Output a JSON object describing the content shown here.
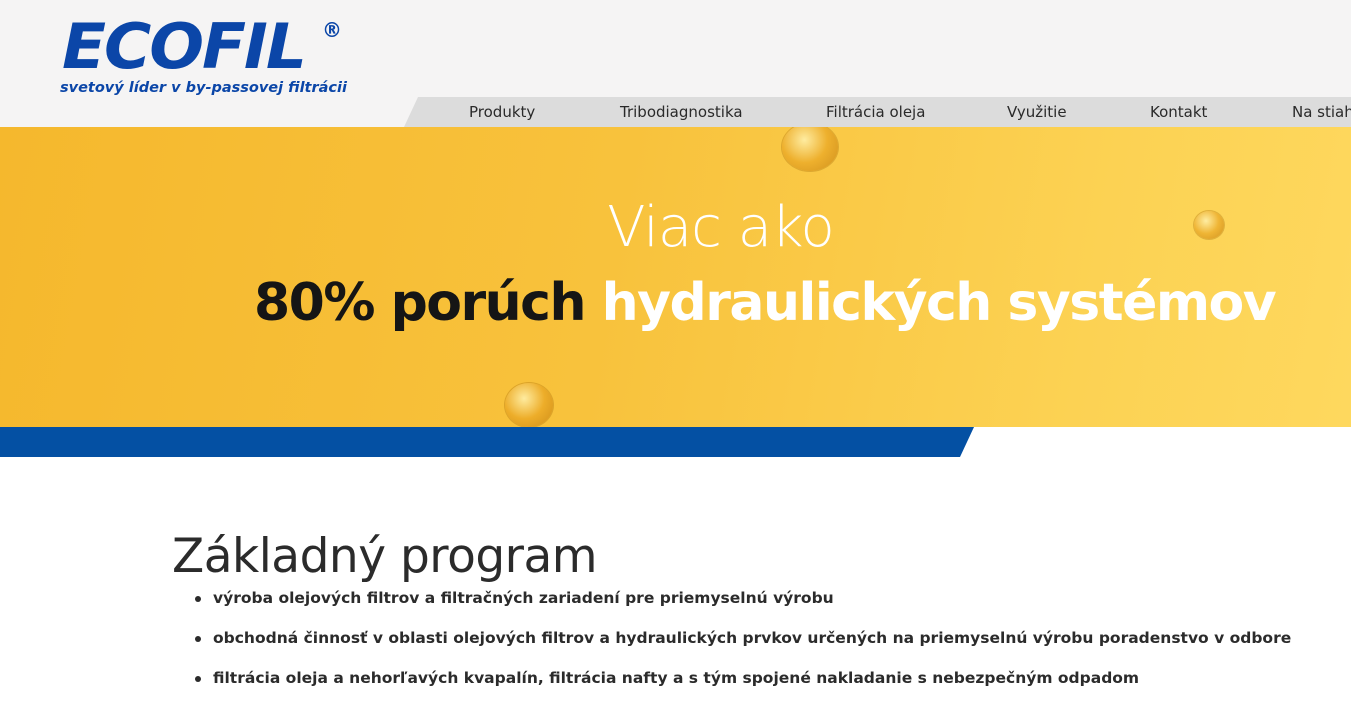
{
  "logo": {
    "wordmark": "ECOFIL",
    "registered": "®",
    "tagline": "svetový líder v by-passovej filtrácii"
  },
  "nav": {
    "items": [
      {
        "label": "Produkty"
      },
      {
        "label": "Tribodiagnostika"
      },
      {
        "label": "Filtrácia oleja"
      },
      {
        "label": "Využitie"
      },
      {
        "label": "Kontakt"
      },
      {
        "label": "Na stiah"
      }
    ]
  },
  "banner": {
    "line1": "Viac ako",
    "line2_dark": "80% porúch",
    "line2_light": "hydraulických systémov"
  },
  "main": {
    "title": "Základný program",
    "bullets": [
      "výroba olejových filtrov a filtračných zariadení pre priemyselnú výrobu",
      "obchodná činnosť v oblasti olejových filtrov a hydraulických prvkov určených na priemyselnú výrobu poradenstvo v odbore",
      "filtrácia oleja a nehorľavých kvapalín, filtrácia nafty a s tým spojené nakladanie s nebezpečným odpadom"
    ]
  },
  "colors": {
    "brand_blue": "#0b46a8",
    "stripe_blue": "#0450a3",
    "banner_yellow": "#f8c23c",
    "nav_bg": "#dcdcdc"
  }
}
